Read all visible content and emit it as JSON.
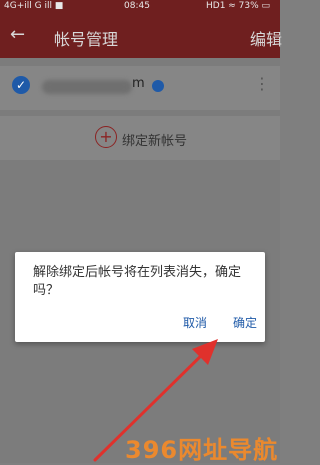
{
  "status_bar": {
    "left": "4G+ill G ill ■",
    "time": "08:45",
    "right": "HD1 ≈ 73% ▭"
  },
  "app_bar": {
    "back_icon": "←",
    "title": "帐号管理",
    "edit": "编辑"
  },
  "accounts": [
    {
      "suffix": "m",
      "selected": true,
      "verified": true
    }
  ],
  "bind_new_account": "绑定新帐号",
  "dialog": {
    "message": "解除绑定后帐号将在列表消失，确定吗？",
    "cancel": "取消",
    "confirm": "确定"
  },
  "watermark": "396网址导航",
  "colors": {
    "app_bar": "#6f1f1f",
    "accent_blue": "#1f5aa8",
    "annotation_red": "#e0312c",
    "watermark_orange": "#ff8c21"
  }
}
